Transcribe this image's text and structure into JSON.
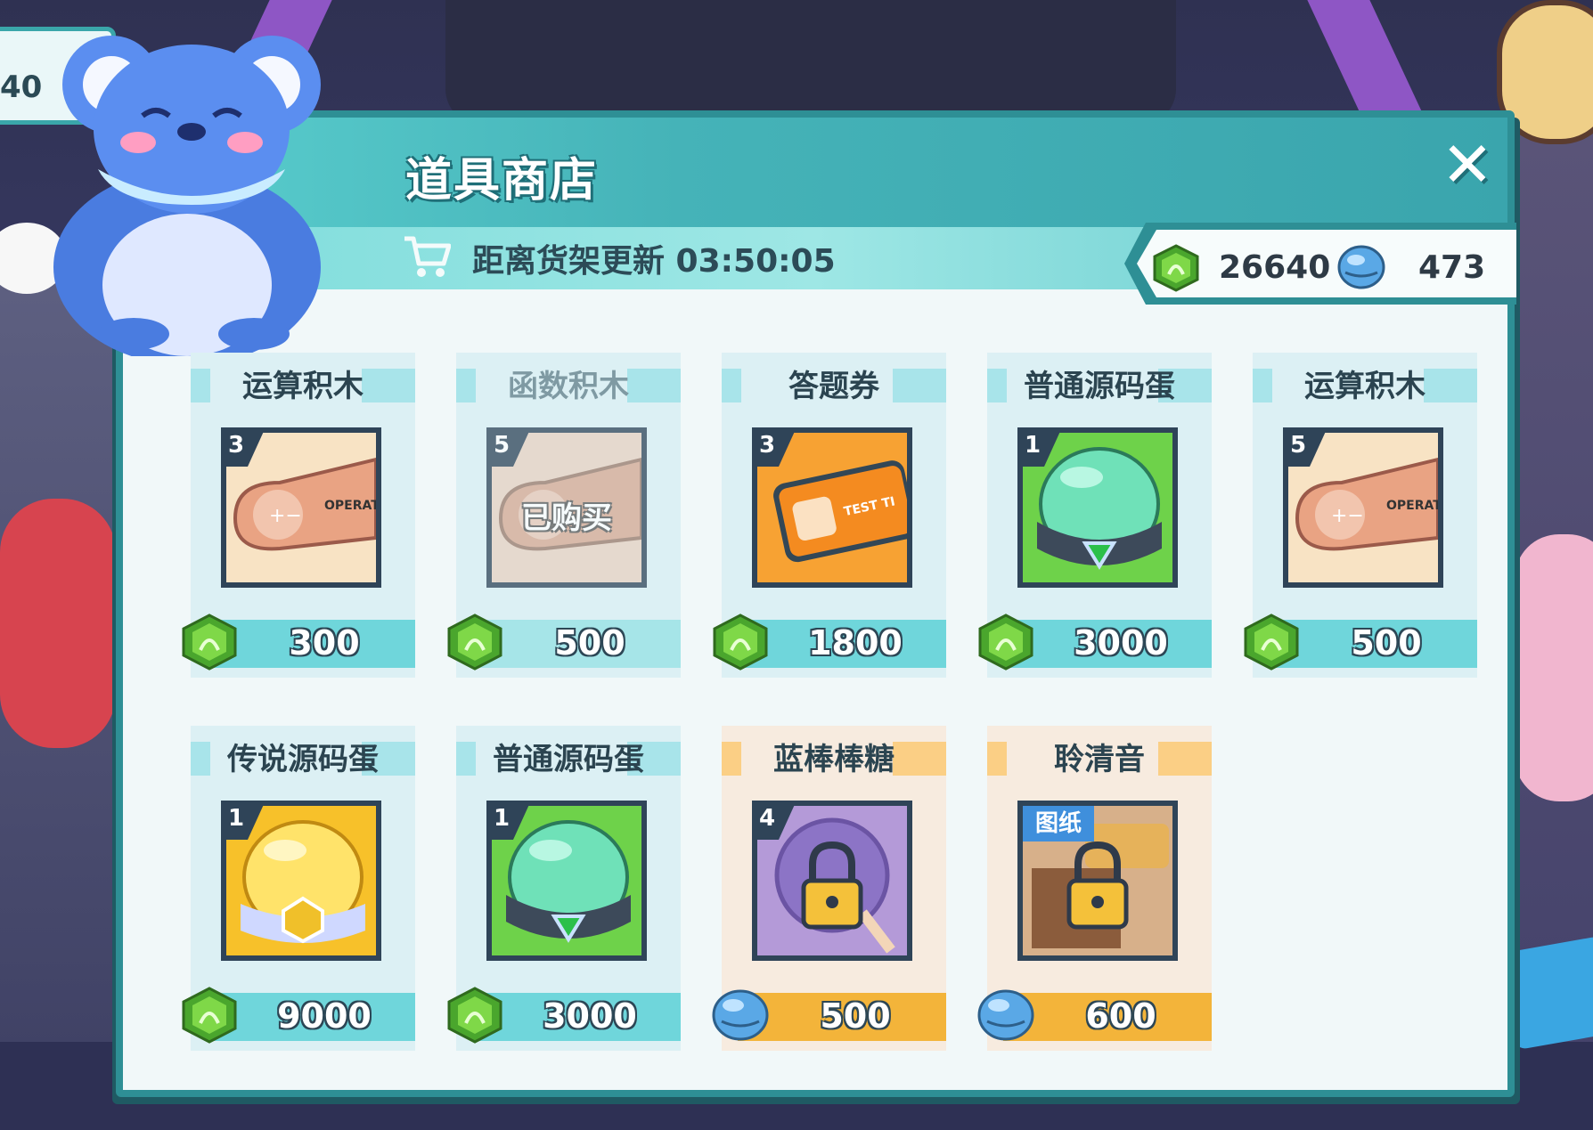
{
  "hud": {
    "side_value": "40"
  },
  "shop": {
    "title": "道具商店",
    "refresh_label": "距离货架更新 03:50:05",
    "close_symbol": "✕"
  },
  "currency": {
    "gems": "26640",
    "bells": "473"
  },
  "items": [
    {
      "name": "运算积木",
      "qty": "3",
      "price": "300",
      "currency": "gem",
      "icon": "operator-block-icon",
      "style": "teal",
      "purchased": false
    },
    {
      "name": "函数积木",
      "qty": "5",
      "price": "500",
      "currency": "gem",
      "icon": "function-block-icon",
      "style": "teal",
      "purchased": true,
      "purchased_label": "已购买"
    },
    {
      "name": "答题券",
      "qty": "3",
      "price": "1800",
      "currency": "gem",
      "icon": "test-ticket-icon",
      "style": "teal",
      "purchased": false
    },
    {
      "name": "普通源码蛋",
      "qty": "1",
      "price": "3000",
      "currency": "gem",
      "icon": "green-source-egg-icon",
      "style": "teal",
      "purchased": false
    },
    {
      "name": "运算积木",
      "qty": "5",
      "price": "500",
      "currency": "gem",
      "icon": "operator-block-icon",
      "style": "teal",
      "purchased": false
    },
    {
      "name": "传说源码蛋",
      "qty": "1",
      "price": "9000",
      "currency": "gem",
      "icon": "legendary-source-egg-icon",
      "style": "teal",
      "purchased": false
    },
    {
      "name": "普通源码蛋",
      "qty": "1",
      "price": "3000",
      "currency": "gem",
      "icon": "green-source-egg-icon",
      "style": "teal",
      "purchased": false
    },
    {
      "name": "蓝棒棒糖",
      "qty": "4",
      "price": "500",
      "currency": "bell",
      "icon": "locked-lollipop-icon",
      "style": "orange",
      "purchased": false
    },
    {
      "name": "聆清音",
      "tag": "图纸",
      "price": "600",
      "currency": "bell",
      "icon": "locked-blueprint-icon",
      "style": "orange",
      "purchased": false
    }
  ],
  "colors": {
    "panel_border": "#2e8f95",
    "header": "#45b3b8",
    "gem": "#5fbf3a",
    "bell": "#6bb8f0",
    "orange_bar": "#f3b43a"
  }
}
